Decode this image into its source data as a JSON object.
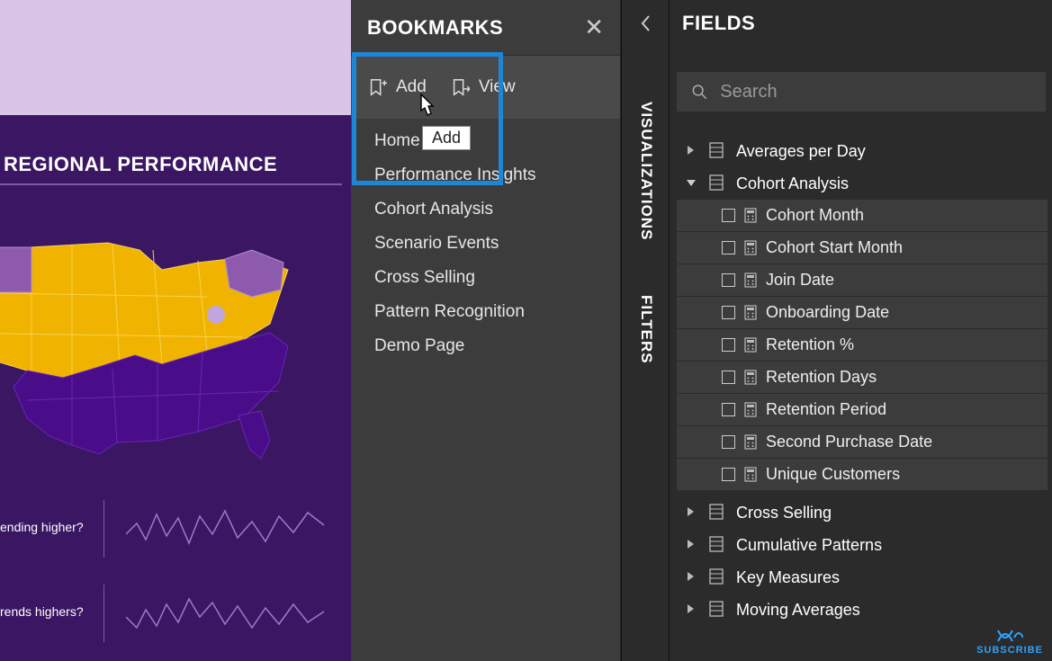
{
  "canvas": {
    "title": "REGIONAL PERFORMANCE",
    "spark1_label": "ending higher?",
    "spark2_label": "rends highers?"
  },
  "bookmarks": {
    "title": "BOOKMARKS",
    "add_label": "Add",
    "view_label": "View",
    "tooltip": "Add",
    "items": [
      "Home",
      "Performance Insights",
      "Cohort Analysis",
      "Scenario Events",
      "Cross Selling",
      "Pattern Recognition",
      "Demo Page"
    ]
  },
  "vertical": {
    "viz": "VISUALIZATIONS",
    "filters": "FILTERS"
  },
  "fields": {
    "title": "FIELDS",
    "search_placeholder": "Search",
    "tables": [
      {
        "name": "Averages per Day",
        "expanded": false,
        "fields": []
      },
      {
        "name": "Cohort Analysis",
        "expanded": true,
        "fields": [
          "Cohort Month",
          "Cohort Start Month",
          "Join Date",
          "Onboarding Date",
          "Retention %",
          "Retention Days",
          "Retention Period",
          "Second Purchase Date",
          "Unique Customers"
        ]
      },
      {
        "name": "Cross Selling",
        "expanded": false,
        "fields": []
      },
      {
        "name": "Cumulative Patterns",
        "expanded": false,
        "fields": []
      },
      {
        "name": "Key Measures",
        "expanded": false,
        "fields": []
      },
      {
        "name": "Moving Averages",
        "expanded": false,
        "fields": []
      }
    ]
  },
  "subscribe": "SUBSCRIBE"
}
